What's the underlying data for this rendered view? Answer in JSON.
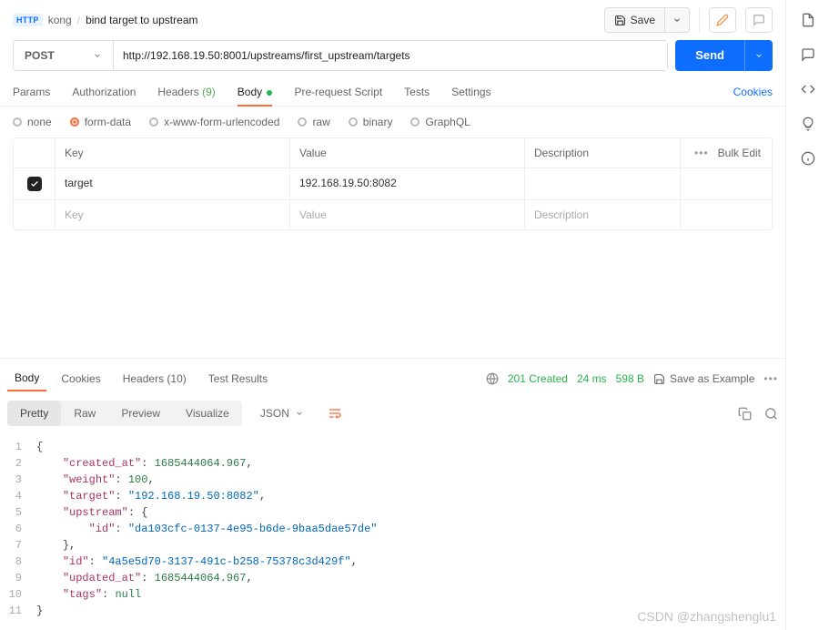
{
  "breadcrumb": {
    "badge": "HTTP",
    "collection": "kong",
    "request": "bind target to upstream"
  },
  "topbar": {
    "save": "Save"
  },
  "request": {
    "method": "POST",
    "url": "http://192.168.19.50:8001/upstreams/first_upstream/targets",
    "send": "Send"
  },
  "reqTabs": {
    "params": "Params",
    "auth": "Authorization",
    "headers": "Headers",
    "headers_count": "(9)",
    "body": "Body",
    "prereq": "Pre-request Script",
    "tests": "Tests",
    "settings": "Settings",
    "cookies": "Cookies"
  },
  "bodyTypes": {
    "none": "none",
    "formdata": "form-data",
    "urlencoded": "x-www-form-urlencoded",
    "raw": "raw",
    "binary": "binary",
    "graphql": "GraphQL"
  },
  "paramsHead": {
    "key": "Key",
    "value": "Value",
    "desc": "Description",
    "bulk": "Bulk Edit"
  },
  "paramsRow": {
    "key": "target",
    "value": "192.168.19.50:8082"
  },
  "paramsNew": {
    "key": "Key",
    "value": "Value",
    "desc": "Description"
  },
  "respTabs": {
    "body": "Body",
    "cookies": "Cookies",
    "headers": "Headers",
    "headers_count": "(10)",
    "test": "Test Results"
  },
  "respMeta": {
    "status": "201 Created",
    "time": "24 ms",
    "size": "598 B",
    "saveex": "Save as Example"
  },
  "viewModes": {
    "pretty": "Pretty",
    "raw": "Raw",
    "preview": "Preview",
    "visualize": "Visualize",
    "format": "JSON"
  },
  "json": {
    "l1": "{",
    "l2_k": "\"created_at\"",
    "l2_v": "1685444064.967",
    "l3_k": "\"weight\"",
    "l3_v": "100",
    "l4_k": "\"target\"",
    "l4_v": "\"192.168.19.50:8082\"",
    "l5_k": "\"upstream\"",
    "l6_k": "\"id\"",
    "l6_v": "\"da103cfc-0137-4e95-b6de-9baa5dae57de\"",
    "l8_k": "\"id\"",
    "l8_v": "\"4a5e5d70-3137-491c-b258-75378c3d429f\"",
    "l9_k": "\"updated_at\"",
    "l9_v": "1685444064.967",
    "l10_k": "\"tags\"",
    "l10_v": "null",
    "l11": "}"
  },
  "watermark": "CSDN @zhangshenglu1"
}
